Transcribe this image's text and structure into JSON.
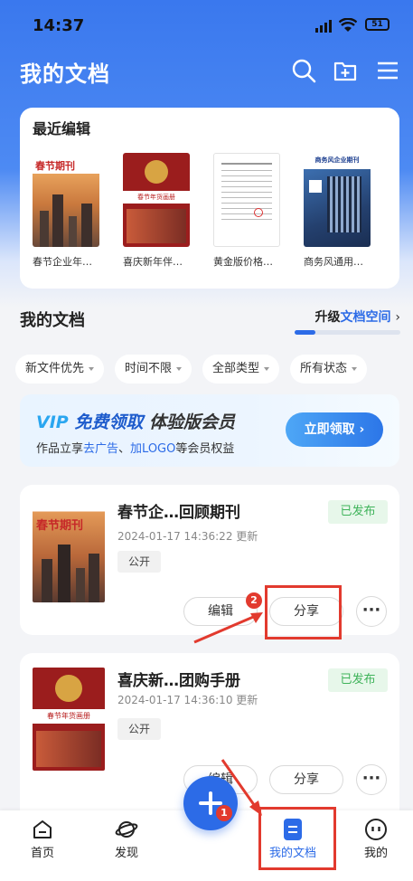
{
  "status_bar": {
    "time": "14:37",
    "battery": "51"
  },
  "header": {
    "title": "我的文档"
  },
  "recent": {
    "title": "最近编辑",
    "items": [
      {
        "caption": "春节企业年…",
        "cover_text": "春节期刊"
      },
      {
        "caption": "喜庆新年伴…",
        "cover_text": "春节年货画册"
      },
      {
        "caption": "黄金版价格…",
        "cover_text": ""
      },
      {
        "caption": "商务风通用…",
        "cover_text": "商务风企业期刊"
      }
    ]
  },
  "docs_section": {
    "title": "我的文档",
    "upgrade_prefix": "升级",
    "upgrade_highlight": "文档空间",
    "storage_used_fraction": 0.2
  },
  "filters": [
    "新文件优先",
    "时间不限",
    "全部类型",
    "所有状态"
  ],
  "vip_banner": {
    "vip_mark": "VIP",
    "headline_a": "免费领取",
    "headline_b": "体验版会员",
    "sub_prefix": "作品立享",
    "sub_hl1": "去广告",
    "sub_mid": "、",
    "sub_hl2": "加LOGO",
    "sub_suffix": "等会员权益",
    "button": "立即领取 ›"
  },
  "documents": [
    {
      "name": "春节企…回顾期刊",
      "date": "2024-01-17 14:36:22 更新",
      "visibility": "公开",
      "status": "已发布",
      "edit": "编辑",
      "share": "分享",
      "cover_text": "春节期刊"
    },
    {
      "name": "喜庆新…团购手册",
      "date": "2024-01-17 14:36:10 更新",
      "visibility": "公开",
      "status": "已发布",
      "edit": "编辑",
      "share": "分享",
      "cover_text": "春节年货画册"
    }
  ],
  "annotations": {
    "step1": "1",
    "step2": "2"
  },
  "tabbar": {
    "home": "首页",
    "discover": "发现",
    "docs": "我的文档",
    "me": "我的"
  },
  "colors": {
    "brand": "#2c6be7",
    "annotation": "#e23a2e",
    "published": "#3fb35a"
  }
}
